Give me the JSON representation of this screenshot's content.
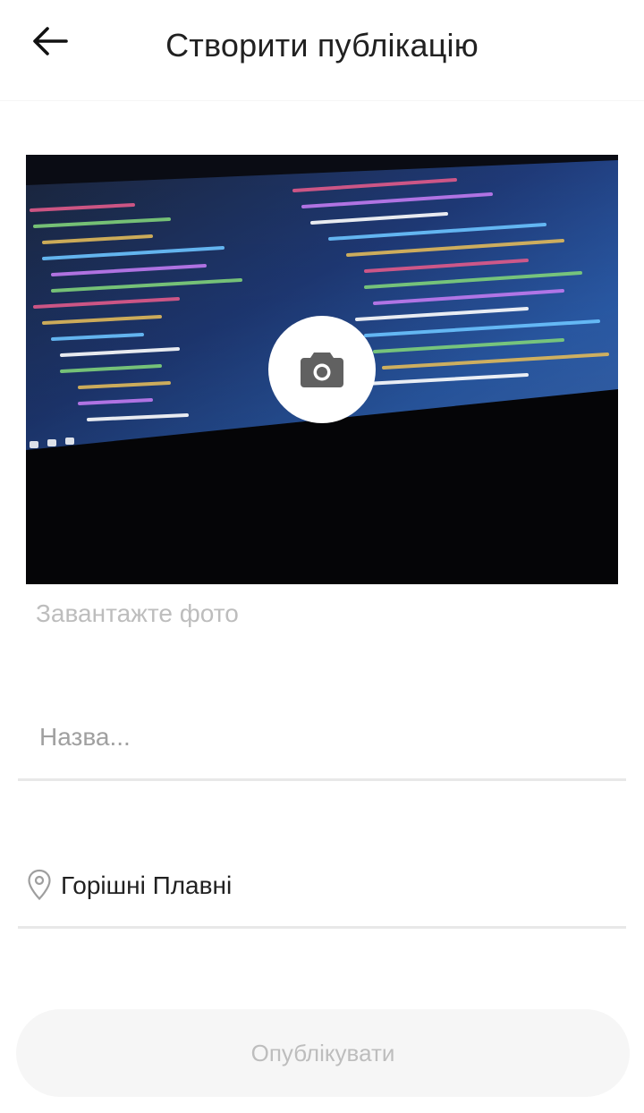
{
  "header": {
    "title": "Створити публікацію",
    "back_icon": "arrow-left-icon"
  },
  "photo": {
    "camera_icon": "camera-icon",
    "hint": "Завантажте фото"
  },
  "form": {
    "title_placeholder": "Назва...",
    "title_value": "",
    "location_icon": "map-pin-icon",
    "location_value": "Горішні Плавні"
  },
  "actions": {
    "publish_label": "Опублікувати"
  },
  "colors": {
    "text": "#212121",
    "placeholder": "#bdbdbd",
    "divider": "#e8e8e8",
    "button_bg": "#f6f6f6"
  }
}
